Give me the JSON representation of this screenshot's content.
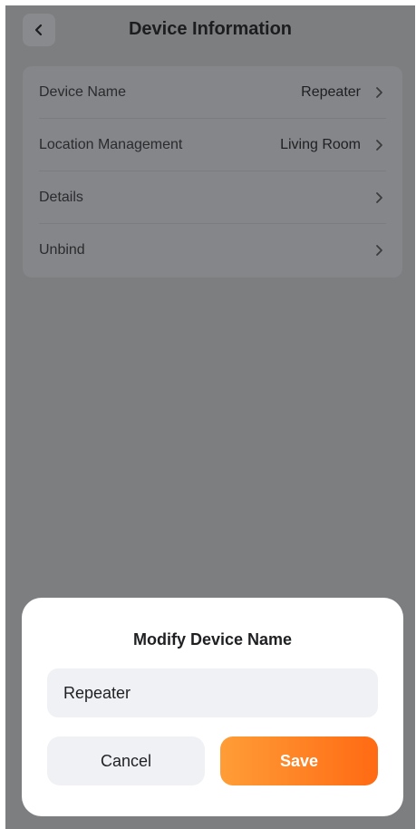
{
  "header": {
    "title": "Device Information",
    "back_icon": "chevron-left-icon"
  },
  "settings": {
    "rows": [
      {
        "label": "Device Name",
        "value": "Repeater"
      },
      {
        "label": "Location Management",
        "value": "Living Room"
      },
      {
        "label": "Details",
        "value": ""
      },
      {
        "label": "Unbind",
        "value": ""
      }
    ],
    "row_icon": "chevron-right-icon"
  },
  "dialog": {
    "title": "Modify Device Name",
    "input_value": "Repeater",
    "cancel_label": "Cancel",
    "save_label": "Save"
  },
  "colors": {
    "overlay": "#7d7e80",
    "accent_start": "#ff9d36",
    "accent_end": "#ff6a13",
    "field_bg": "#eff1f4"
  }
}
